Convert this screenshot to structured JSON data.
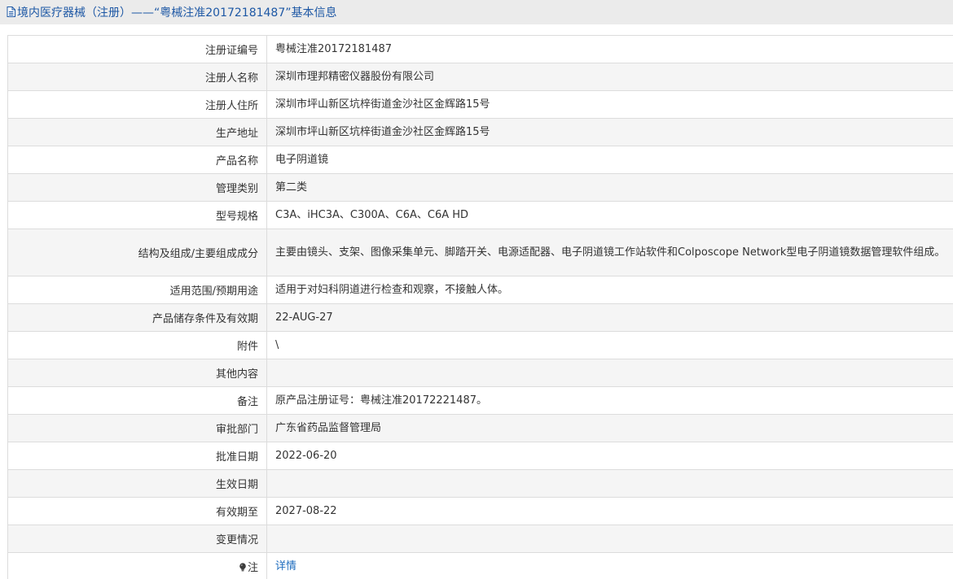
{
  "header": {
    "title": "境内医疗器械（注册）——“粤械注准20172181487”基本信息",
    "icon": "document-icon"
  },
  "rows": [
    {
      "label": "注册证编号",
      "value": "粤械注准20172181487"
    },
    {
      "label": "注册人名称",
      "value": "深圳市理邦精密仪器股份有限公司"
    },
    {
      "label": "注册人住所",
      "value": "深圳市坪山新区坑梓街道金沙社区金辉路15号"
    },
    {
      "label": "生产地址",
      "value": "深圳市坪山新区坑梓街道金沙社区金辉路15号"
    },
    {
      "label": "产品名称",
      "value": "电子阴道镜"
    },
    {
      "label": "管理类别",
      "value": "第二类"
    },
    {
      "label": "型号规格",
      "value": "C3A、iHC3A、C300A、C6A、C6A HD"
    },
    {
      "label": "结构及组成/主要组成成分",
      "value": "主要由镜头、支架、图像采集单元、脚踏开关、电源适配器、电子阴道镜工作站软件和Colposcope Network型电子阴道镜数据管理软件组成。"
    },
    {
      "label": "适用范围/预期用途",
      "value": "适用于对妇科阴道进行检查和观察，不接触人体。"
    },
    {
      "label": "产品储存条件及有效期",
      "value": "22-AUG-27"
    },
    {
      "label": "附件",
      "value": "\\"
    },
    {
      "label": "其他内容",
      "value": ""
    },
    {
      "label": "备注",
      "value": "原产品注册证号：粤械注准20172221487。"
    },
    {
      "label": "审批部门",
      "value": "广东省药品监督管理局"
    },
    {
      "label": "批准日期",
      "value": "2022-06-20"
    },
    {
      "label": "生效日期",
      "value": ""
    },
    {
      "label": "有效期至",
      "value": "2027-08-22"
    },
    {
      "label": "变更情况",
      "value": ""
    }
  ],
  "note_row": {
    "label": "注",
    "icon": "lightbulb-icon",
    "link_text": "详情"
  },
  "colors": {
    "title_text": "#1e58a5",
    "title_bg": "#ebebeb",
    "row_alt_bg": "#f5f5f5",
    "border": "#dcdcdc",
    "link": "#1e6cbe"
  }
}
